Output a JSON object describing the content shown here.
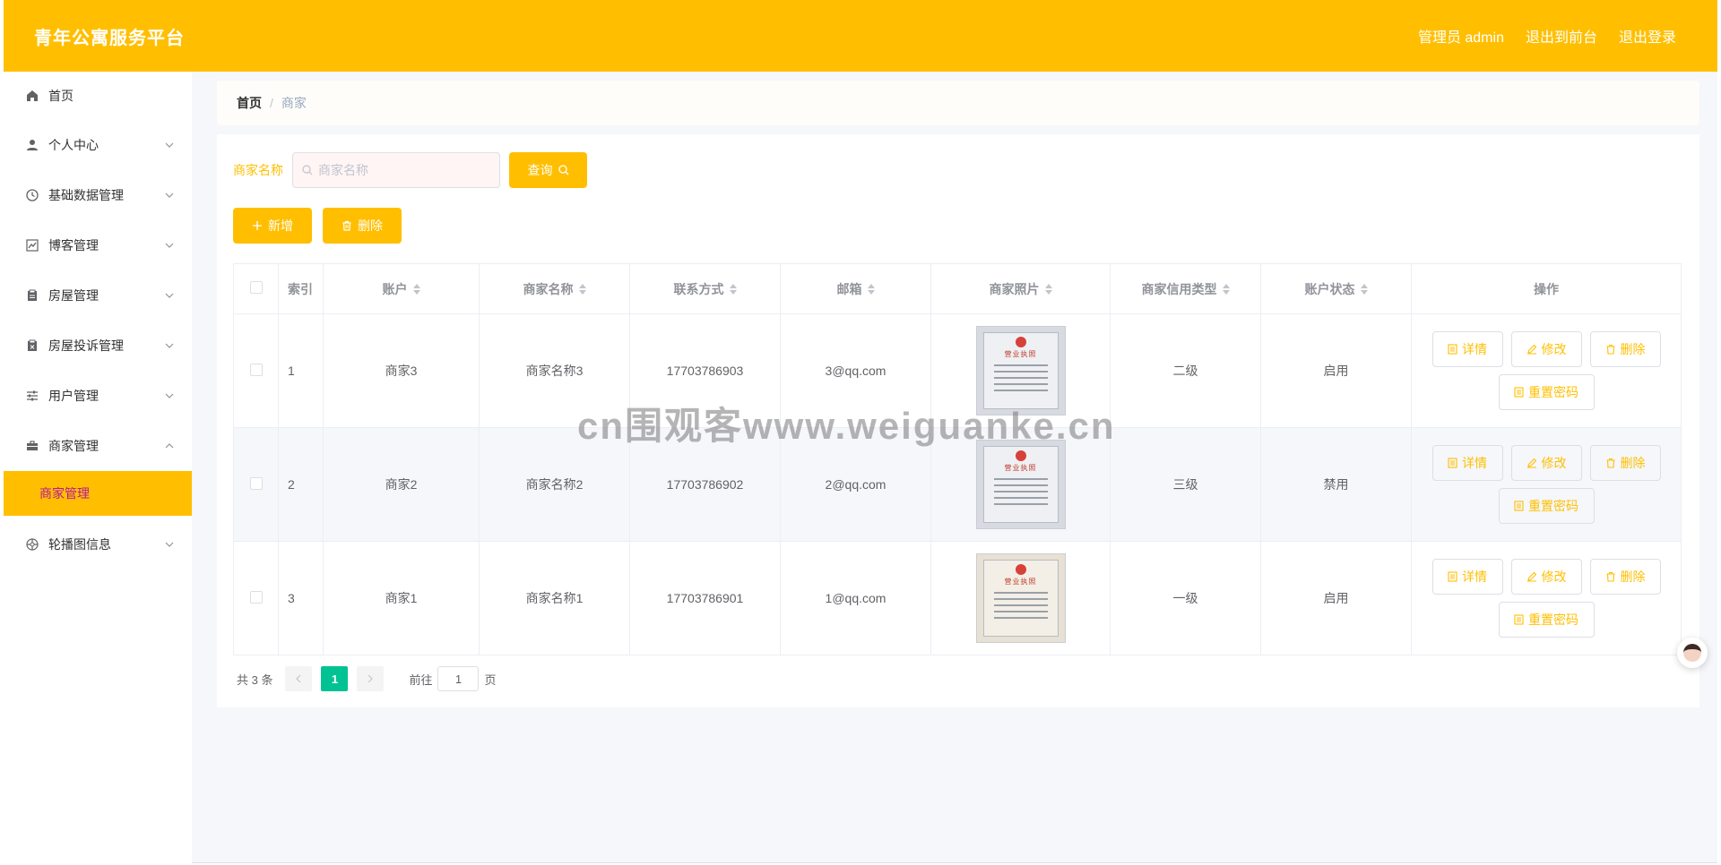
{
  "header": {
    "title": "青年公寓服务平台",
    "admin_label": "管理员 admin",
    "to_front": "退出到前台",
    "logout": "退出登录"
  },
  "sidebar": {
    "items": [
      {
        "label": "首页",
        "icon": "home-icon"
      },
      {
        "label": "个人中心",
        "icon": "user-icon"
      },
      {
        "label": "基础数据管理",
        "icon": "clock-icon"
      },
      {
        "label": "博客管理",
        "icon": "chart-icon"
      },
      {
        "label": "房屋管理",
        "icon": "clipboard-icon"
      },
      {
        "label": "房屋投诉管理",
        "icon": "clipboard-x-icon"
      },
      {
        "label": "用户管理",
        "icon": "sliders-icon"
      },
      {
        "label": "商家管理",
        "icon": "briefcase-icon"
      },
      {
        "label": "轮播图信息",
        "icon": "target-icon"
      }
    ],
    "active_sub": "商家管理"
  },
  "breadcrumb": {
    "home": "首页",
    "sep": "/",
    "current": "商家"
  },
  "search": {
    "label": "商家名称",
    "placeholder": "商家名称",
    "button": "查询"
  },
  "actions": {
    "add": "新增",
    "delete": "删除"
  },
  "table": {
    "headers": {
      "index": "索引",
      "account": "账户",
      "name": "商家名称",
      "phone": "联系方式",
      "email": "邮箱",
      "photo": "商家照片",
      "credit": "商家信用类型",
      "status": "账户状态",
      "ops": "操作"
    },
    "rows": [
      {
        "index": "1",
        "account": "商家3",
        "name": "商家名称3",
        "phone": "17703786903",
        "email": "3@qq.com",
        "photo_title": "营业执照",
        "credit": "二级",
        "status": "启用"
      },
      {
        "index": "2",
        "account": "商家2",
        "name": "商家名称2",
        "phone": "17703786902",
        "email": "2@qq.com",
        "photo_title": "营业执照",
        "credit": "三级",
        "status": "禁用"
      },
      {
        "index": "3",
        "account": "商家1",
        "name": "商家名称1",
        "phone": "17703786901",
        "email": "1@qq.com",
        "photo_title": "营业执照",
        "credit": "一级",
        "status": "启用"
      }
    ],
    "op_labels": {
      "detail": "详情",
      "edit": "修改",
      "delete": "删除",
      "reset": "重置密码"
    }
  },
  "pagination": {
    "total": "共 3 条",
    "current": "1",
    "goto_prefix": "前往",
    "goto_value": "1",
    "goto_suffix": "页"
  },
  "watermark": "cn围观客www.weiguanke.cn",
  "colors": {
    "accent": "#ffbf00",
    "page_active": "#00c292",
    "submenu_text": "#b5179e"
  }
}
